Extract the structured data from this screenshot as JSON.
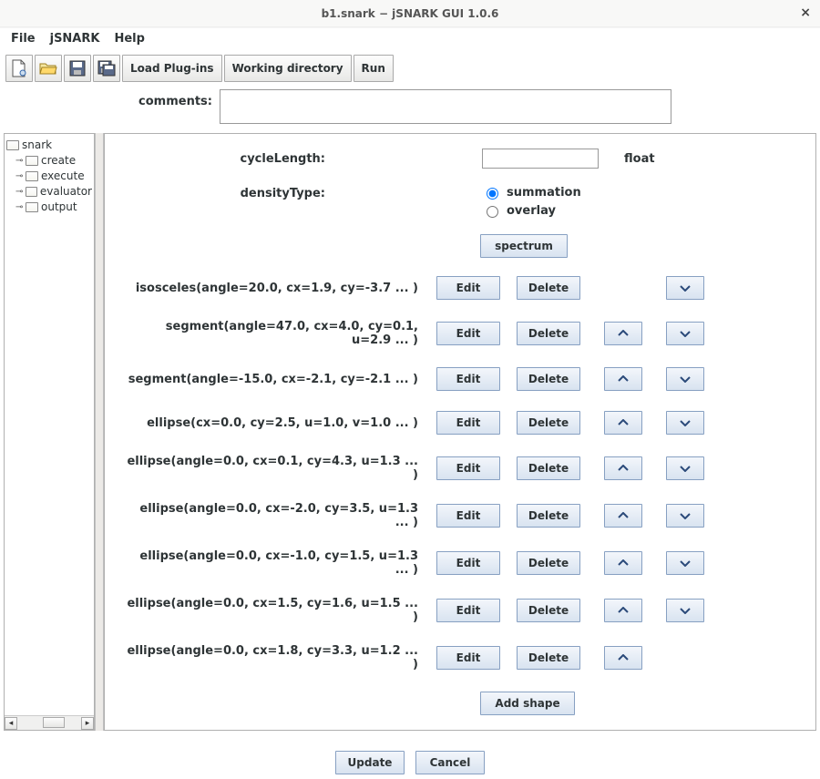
{
  "window": {
    "title": "b1.snark − jSNARK GUI 1.0.6"
  },
  "menu": {
    "file": "File",
    "jsnark": "jSNARK",
    "help": "Help"
  },
  "toolbar": {
    "load_plugins": "Load Plug-ins",
    "working_directory": "Working directory",
    "run": "Run"
  },
  "comments": {
    "label": "comments:",
    "value": ""
  },
  "tree": {
    "root": "snark",
    "children": [
      "create",
      "execute",
      "evaluator",
      "output"
    ]
  },
  "form": {
    "cycleLength": {
      "label": "cycleLength:",
      "value": "",
      "type": "float"
    },
    "densityType": {
      "label": "densityType:",
      "options": [
        "summation",
        "overlay"
      ],
      "selected": "summation"
    },
    "spectrum": "spectrum",
    "add_shape": "Add shape"
  },
  "shape_buttons": {
    "edit": "Edit",
    "delete": "Delete"
  },
  "shapes": [
    {
      "text": "isosceles(angle=20.0, cx=1.9, cy=-3.7 ... )",
      "up": false,
      "down": true
    },
    {
      "text": "segment(angle=47.0, cx=4.0, cy=0.1, u=2.9 ... )",
      "up": true,
      "down": true
    },
    {
      "text": "segment(angle=-15.0, cx=-2.1, cy=-2.1 ... )",
      "up": true,
      "down": true
    },
    {
      "text": "ellipse(cx=0.0, cy=2.5, u=1.0, v=1.0 ... )",
      "up": true,
      "down": true
    },
    {
      "text": "ellipse(angle=0.0, cx=0.1, cy=4.3, u=1.3 ... )",
      "up": true,
      "down": true
    },
    {
      "text": "ellipse(angle=0.0, cx=-2.0, cy=3.5, u=1.3 ... )",
      "up": true,
      "down": true
    },
    {
      "text": "ellipse(angle=0.0, cx=-1.0, cy=1.5, u=1.3 ... )",
      "up": true,
      "down": true
    },
    {
      "text": "ellipse(angle=0.0, cx=1.5, cy=1.6, u=1.5 ... )",
      "up": true,
      "down": true
    },
    {
      "text": "ellipse(angle=0.0, cx=1.8, cy=3.3, u=1.2 ... )",
      "up": true,
      "down": false
    }
  ],
  "bottom": {
    "update": "Update",
    "cancel": "Cancel"
  }
}
